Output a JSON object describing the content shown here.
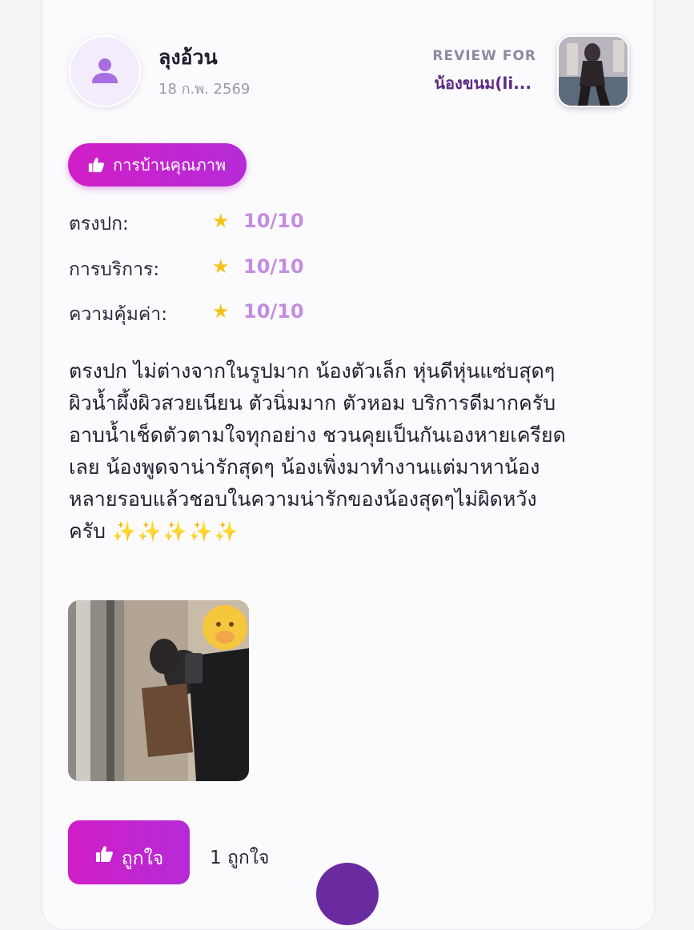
{
  "review": {
    "author": "ลุงอ้วน",
    "date": "18 ก.พ. 2569",
    "review_for_label": "REVIEW FOR",
    "review_for_name": "น้องขนม(li...",
    "tag": "การบ้านคุณภาพ",
    "ratings": [
      {
        "label": "ตรงปก:",
        "score": "10/10"
      },
      {
        "label": "การบริการ:",
        "score": "10/10"
      },
      {
        "label": "ความคุ้มค่า:",
        "score": "10/10"
      }
    ],
    "text_lines": [
      "ตรงปก ไม่ต่างจากในรูปมาก น้องตัวเล็ก หุ่นดีหุ่นแซ่บสุดๆ",
      "ผิวน้ำผึ้งผิวสวยเนียน ตัวนิ่มมาก ตัวหอม บริการดีมากครับ",
      "อาบน้ำเช็ดตัวตามใจทุกอย่าง ชวนคุยเป็นกันเองหายเครียด",
      "เลย น้องพูดจาน่ารักสุดๆ น้องเพิ่งมาทำงานแต่มาหาน้อง",
      "หลายรอบแล้วชอบในความน่ารักของน้องสุดๆไม่ผิดหวัง",
      "ครับ"
    ],
    "sparkles": "✨✨✨✨✨",
    "like_button": "ถูกใจ",
    "like_count": "1 ถูกใจ"
  },
  "icons": {
    "avatar": "user-icon",
    "tag": "thumbs-up-icon",
    "rating": "star-icon",
    "like": "thumbs-up-icon"
  },
  "colors": {
    "accent": "#d11ec7",
    "accent2": "#b52bd6",
    "star": "#f4c21c",
    "score": "#c28de0",
    "purple_text": "#5b2a86"
  }
}
